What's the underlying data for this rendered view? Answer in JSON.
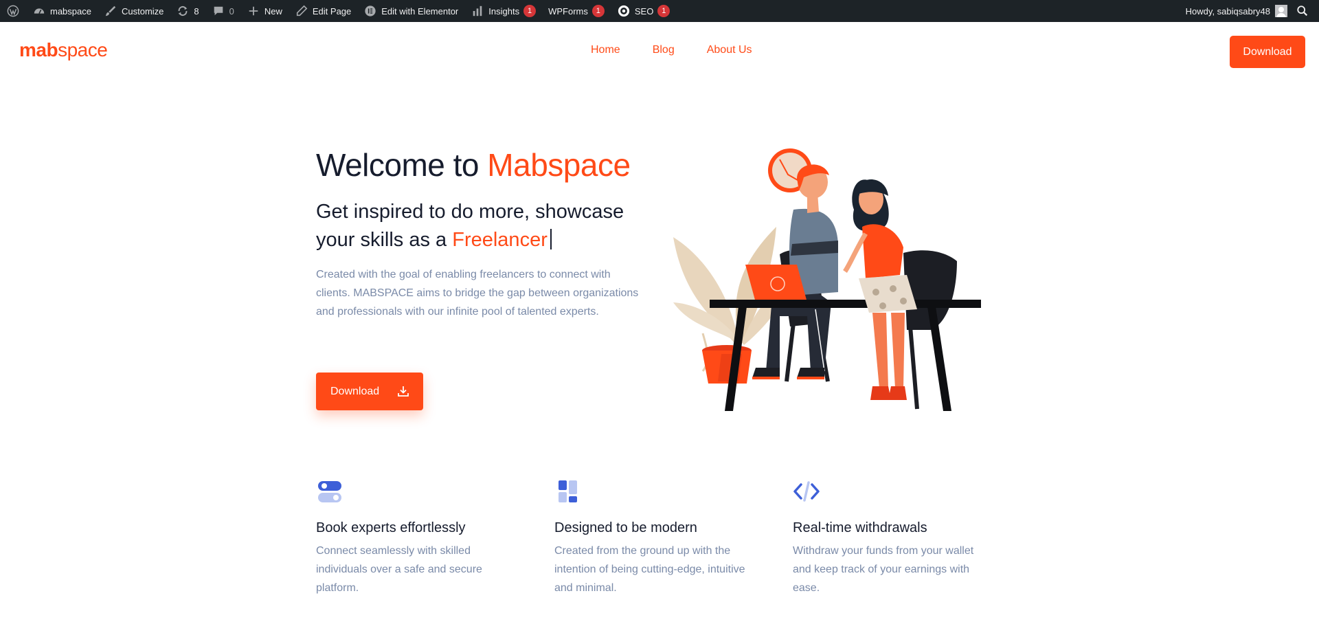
{
  "admin_bar": {
    "site_name": "mabspace",
    "customize": "Customize",
    "updates_count": "8",
    "comments_count": "0",
    "new": "New",
    "edit_page": "Edit Page",
    "edit_elementor": "Edit with Elementor",
    "insights": "Insights",
    "insights_badge": "1",
    "wpforms": "WPForms",
    "wpforms_badge": "1",
    "seo": "SEO",
    "seo_badge": "1",
    "howdy": "Howdy, sabiqsabry48"
  },
  "header": {
    "logo_part1": "mab",
    "logo_part2": "space",
    "nav": [
      "Home",
      "Blog",
      "About Us"
    ],
    "download_button": "Download"
  },
  "hero": {
    "title_prefix": "Welcome to ",
    "title_accent": "Mabspace",
    "subtitle_line": "Get inspired to do more, showcase your skills as a ",
    "subtitle_accent": "Freelancer",
    "description": "Created with the goal of enabling freelancers to connect with clients. MABSPACE aims to bridge the gap between organizations and professionals with our infinite pool of talented experts.",
    "download_button": "Download"
  },
  "features": [
    {
      "icon": "toggle-icon",
      "title": "Book experts effortlessly",
      "description": "Connect seamlessly with skilled individuals over a safe and secure platform."
    },
    {
      "icon": "layout-icon",
      "title": "Designed to be modern",
      "description": "Created from the ground up with the intention of being cutting-edge, intuitive and minimal."
    },
    {
      "icon": "code-icon",
      "title": "Real-time withdrawals",
      "description": "Withdraw your funds from your wallet and keep track of your earnings with ease."
    }
  ],
  "colors": {
    "accent": "#ff4a17",
    "heading": "#161c2d",
    "muted": "#7a8aa8",
    "feature_icon": "#3d5fd8",
    "admin_bar": "#1d2327"
  }
}
